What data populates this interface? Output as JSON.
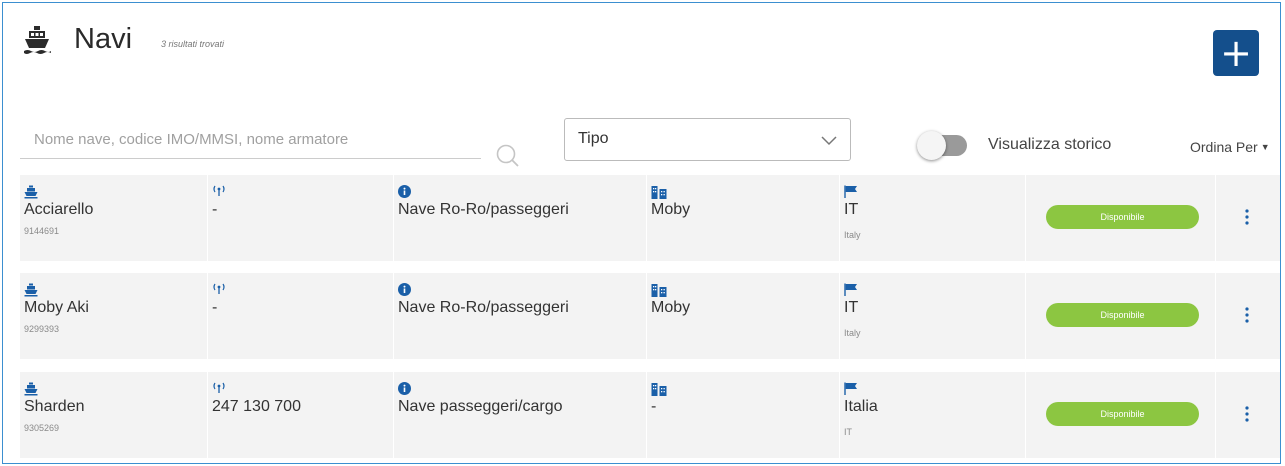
{
  "header": {
    "title": "Navi",
    "result_count": "3 risultati trovati",
    "add_label": "+",
    "title_icon": "ship-icon"
  },
  "filters": {
    "search_placeholder": "Nome nave, codice IMO/MMSI, nome armatore",
    "type_label": "Tipo",
    "toggle_label": "Visualizza storico",
    "toggle_on": false,
    "sort_label": "Ordina Per"
  },
  "colors": {
    "accent": "#144f8c",
    "icon_blue": "#1a5fa8",
    "status_green": "#8cc641",
    "row_bg": "#f3f3f3"
  },
  "rows": [
    {
      "name": "Acciarello",
      "imo": "9144691",
      "mmsi": "-",
      "type": "Nave Ro-Ro/passeggeri",
      "owner": "Moby",
      "flag": "IT",
      "flag_sub": "Italy",
      "status": "Disponibile"
    },
    {
      "name": "Moby Aki",
      "imo": "9299393",
      "mmsi": "-",
      "type": "Nave Ro-Ro/passeggeri",
      "owner": "Moby",
      "flag": "IT",
      "flag_sub": "Italy",
      "status": "Disponibile"
    },
    {
      "name": "Sharden",
      "imo": "9305269",
      "mmsi": "247 130 700",
      "type": "Nave passeggeri/cargo",
      "owner": "-",
      "flag": "Italia",
      "flag_sub": "IT",
      "status": "Disponibile"
    }
  ]
}
